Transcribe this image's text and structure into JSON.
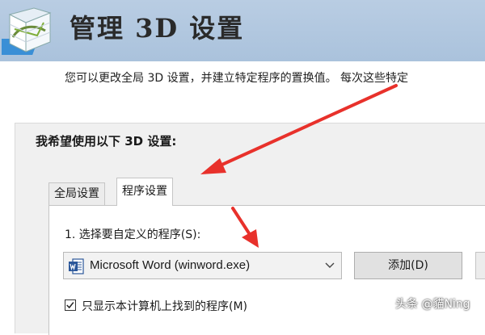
{
  "header": {
    "title": "管理 3D 设置",
    "logo_icon": "nvidia-3d-settings-icon"
  },
  "description": "您可以更改全局 3D 设置，并建立特定程序的置换值。 每次这些特定",
  "settings": {
    "prefer_label": "我希望使用以下 3D 设置:",
    "tabs": [
      {
        "label": "全局设置",
        "selected": false
      },
      {
        "label": "程序设置",
        "selected": true
      }
    ],
    "step_label": "1. 选择要自定义的程序(S):",
    "program_select": {
      "value": "Microsoft Word (winword.exe)",
      "icon": "word-icon"
    },
    "add_button": "添加(D)",
    "show_only_found": {
      "label": "只显示本计算机上找到的程序(M)",
      "checked": true
    }
  },
  "watermark": "头条 @貓Ning",
  "annotation": {
    "arrow_color": "#e8312b"
  }
}
